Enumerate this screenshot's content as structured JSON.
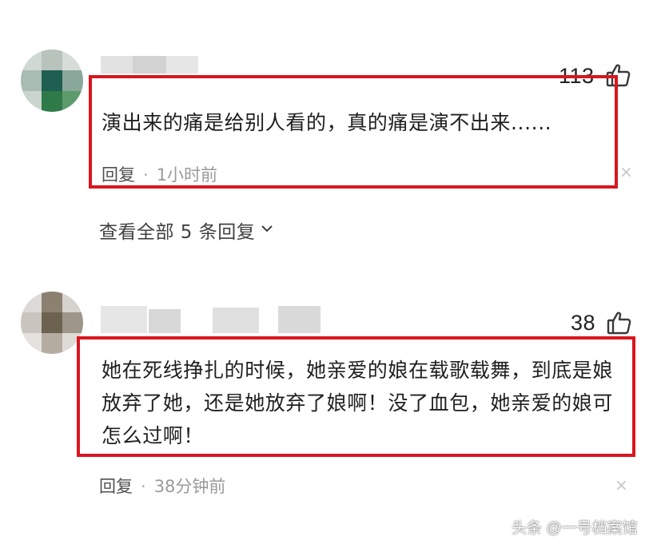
{
  "comments": [
    {
      "likes": "113",
      "text": "演出来的痛是给别人看的，真的痛是演不出来......",
      "reply_label": "回复",
      "separator": "·",
      "time": "1小时前",
      "expand_label": "查看全部 5 条回复",
      "close": "×"
    },
    {
      "likes": "38",
      "text": "她在死线挣扎的时候，她亲爱的娘在载歌载舞，到底是娘放弃了她，还是她放弃了娘啊！没了血包，她亲爱的娘可怎么过啊！",
      "reply_label": "回复",
      "separator": "·",
      "time": "38分钟前",
      "close": "×"
    }
  ],
  "watermark": "头条 @一号档案馆",
  "colors": {
    "highlight": "#d9161f",
    "text": "#1f1f1f",
    "meta": "#9a9a9a"
  },
  "icons": [
    "thumbs-up-icon",
    "chevron-down-icon",
    "close-icon"
  ]
}
